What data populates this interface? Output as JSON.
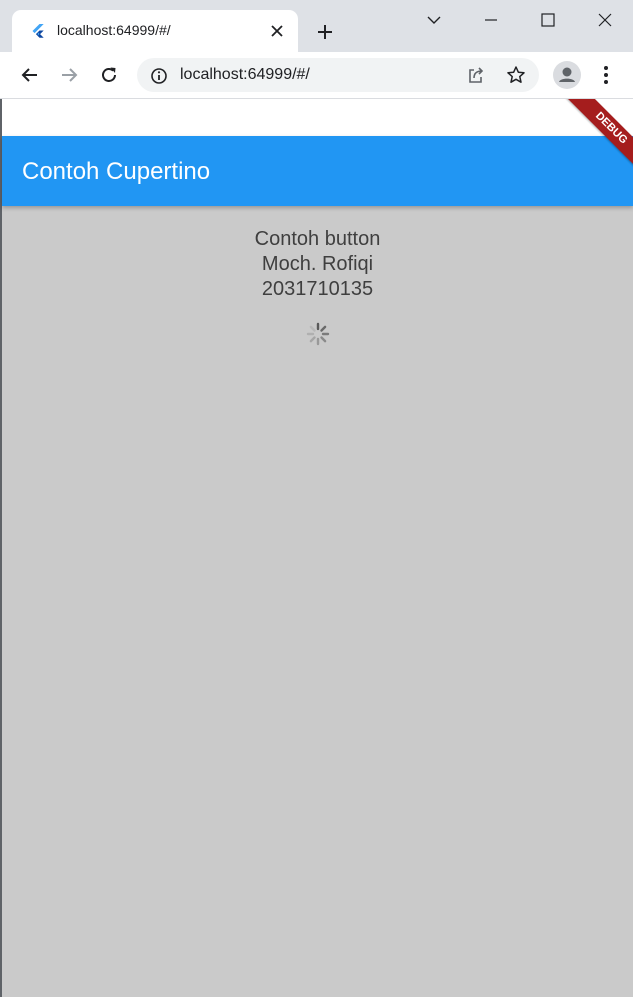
{
  "browser": {
    "tab_title": "localhost:64999/#/",
    "url": "localhost:64999/#/"
  },
  "app": {
    "appbar_title": "Contoh Cupertino",
    "body_lines": [
      "Contoh button",
      "Moch. Rofiqi",
      "2031710135"
    ],
    "debug_label": "DEBUG",
    "colors": {
      "appbar": "#2196f3",
      "background": "#cacaca",
      "debug_ribbon": "#a51d1d"
    }
  }
}
